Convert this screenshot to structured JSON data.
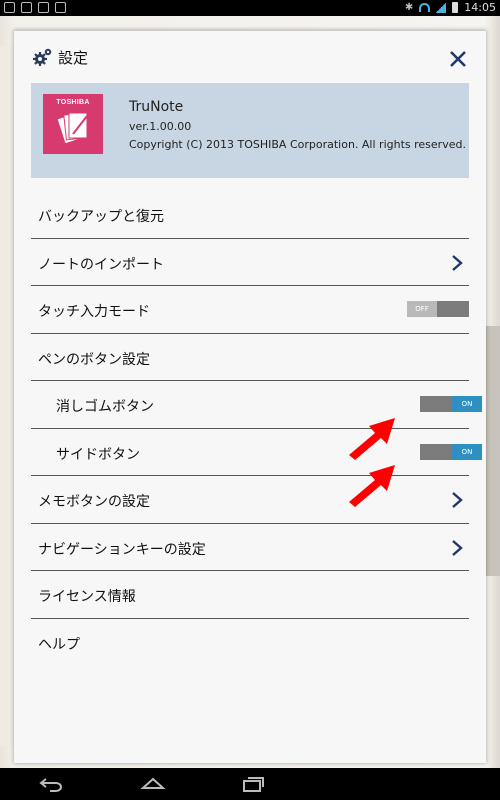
{
  "status_bar": {
    "time": "14:05",
    "bluetooth": "✱"
  },
  "dialog": {
    "title": "設定",
    "app": {
      "logo_text": "TOSHIBA",
      "name": "TruNote",
      "version": "ver.1.00.00",
      "copyright": "Copyright (C) 2013 TOSHIBA Corporation. All rights reserved."
    },
    "rows": {
      "backup": "バックアップと復元",
      "import": "ノートのインポート",
      "touch_mode": "タッチ入力モード",
      "touch_mode_state": "OFF",
      "pen_buttons": "ペンのボタン設定",
      "eraser_button": "消しゴムボタン",
      "eraser_state": "ON",
      "side_button": "サイドボタン",
      "side_state": "ON",
      "memo_button": "メモボタンの設定",
      "navigation_key": "ナビゲーションキーの設定",
      "license": "ライセンス情報",
      "help": "ヘルプ"
    }
  },
  "colors": {
    "accent": "#2e8fc2",
    "logo": "#d63a6e",
    "info_bg": "#c8d6e4",
    "arrow": "#ff0000"
  },
  "icons": [
    "gear-icon",
    "close-icon",
    "chevron-right-icon",
    "back-icon",
    "home-icon",
    "recent-apps-icon"
  ]
}
